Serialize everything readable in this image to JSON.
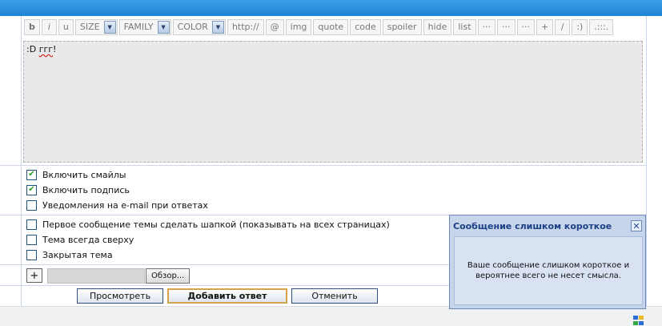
{
  "toolbar": {
    "buttons": {
      "bold": "b",
      "italic": "i",
      "underline": "u",
      "size": "SIZE",
      "family": "FAMILY",
      "color": "COLOR",
      "url": "http://",
      "email": "@",
      "img": "img",
      "quote": "quote",
      "code": "code",
      "spoiler": "spoiler",
      "hide": "hide",
      "list": "list",
      "more1": "···",
      "more2": "···",
      "more3": "···",
      "plus": "+",
      "slash": "/",
      "smile": ":)",
      "extra": ".:::."
    }
  },
  "editor": {
    "emoticon": ":D",
    "word": "ггг",
    "punct": "!"
  },
  "options": {
    "enable_smileys": {
      "label": "Включить смайлы",
      "checked": true
    },
    "enable_signature": {
      "label": "Включить подпись",
      "checked": true
    },
    "email_notify": {
      "label": "Уведомления на e-mail при ответах",
      "checked": false
    },
    "first_post_header": {
      "label": "Первое сообщение темы сделать шапкой (показывать на всех страницах)",
      "checked": false
    },
    "pin_topic": {
      "label": "Тема всегда сверху",
      "checked": false
    },
    "closed_topic": {
      "label": "Закрытая тема",
      "checked": false
    }
  },
  "attachments": {
    "add_label": "+",
    "browse_label": "Обзор..."
  },
  "actions": {
    "preview": "Просмотреть",
    "submit": "Добавить ответ",
    "cancel": "Отменить"
  },
  "popup": {
    "title": "Сообщение слишком короткое",
    "message": "Ваше сообщение слишком короткое и вероятнее всего не несет смысла.",
    "close": "✕"
  },
  "icons": {
    "checkmark": "check-icon",
    "dropdown": "chevron-down-icon",
    "close": "close-icon"
  },
  "colors": {
    "accent": "#1b83d6",
    "checkmark": "#21a121",
    "popup_title": "#1c3f86"
  }
}
